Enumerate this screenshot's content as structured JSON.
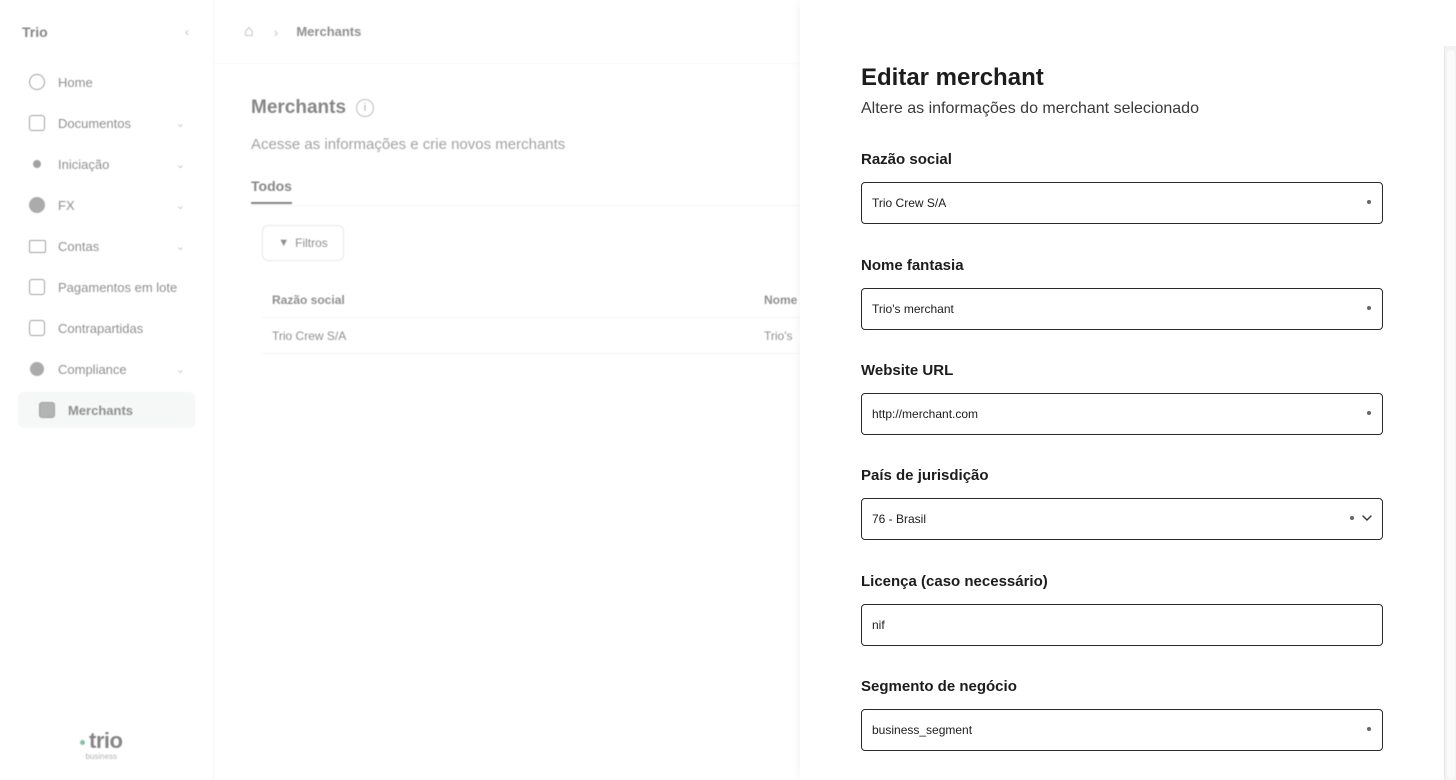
{
  "sidebar": {
    "brand": "Trio",
    "items": [
      {
        "label": "Home",
        "icon": "home-icon"
      },
      {
        "label": "Documentos",
        "icon": "document-icon"
      },
      {
        "label": "Iniciação",
        "icon": "arrow-icon"
      },
      {
        "label": "FX",
        "icon": "currency-icon"
      },
      {
        "label": "Contas",
        "icon": "card-icon"
      },
      {
        "label": "Pagamentos em lote",
        "icon": "batch-payment-icon"
      },
      {
        "label": "Contrapartidas",
        "icon": "counterparty-icon"
      },
      {
        "label": "Compliance",
        "icon": "shield-icon"
      },
      {
        "label": "Merchants",
        "icon": "store-icon"
      }
    ],
    "logo_word": "trio",
    "logo_sub": "business"
  },
  "topbar": {
    "crumb": "Merchants"
  },
  "page": {
    "title": "Merchants",
    "subtitle": "Acesse as informações e crie novos merchants",
    "tab": "Todos",
    "filter_label": "Filtros",
    "table_headers": [
      "Razão social",
      "Nome"
    ],
    "table_rows": [
      [
        "Trio Crew S/A",
        "Trio's"
      ]
    ]
  },
  "drawer": {
    "title": "Editar merchant",
    "subtitle": "Altere as informações do merchant selecionado",
    "fields": {
      "razao": {
        "label": "Razão social",
        "value": "Trio Crew S/A"
      },
      "fantasia": {
        "label": "Nome fantasia",
        "value": "Trio's merchant"
      },
      "website": {
        "label": "Website URL",
        "value": "http://merchant.com"
      },
      "pais": {
        "label": "País de jurisdição",
        "value": "76 - Brasil"
      },
      "licenca": {
        "label": "Licença (caso necessário)",
        "value": "nif"
      },
      "segmento": {
        "label": "Segmento de negócio",
        "value": "business_segment"
      }
    }
  }
}
